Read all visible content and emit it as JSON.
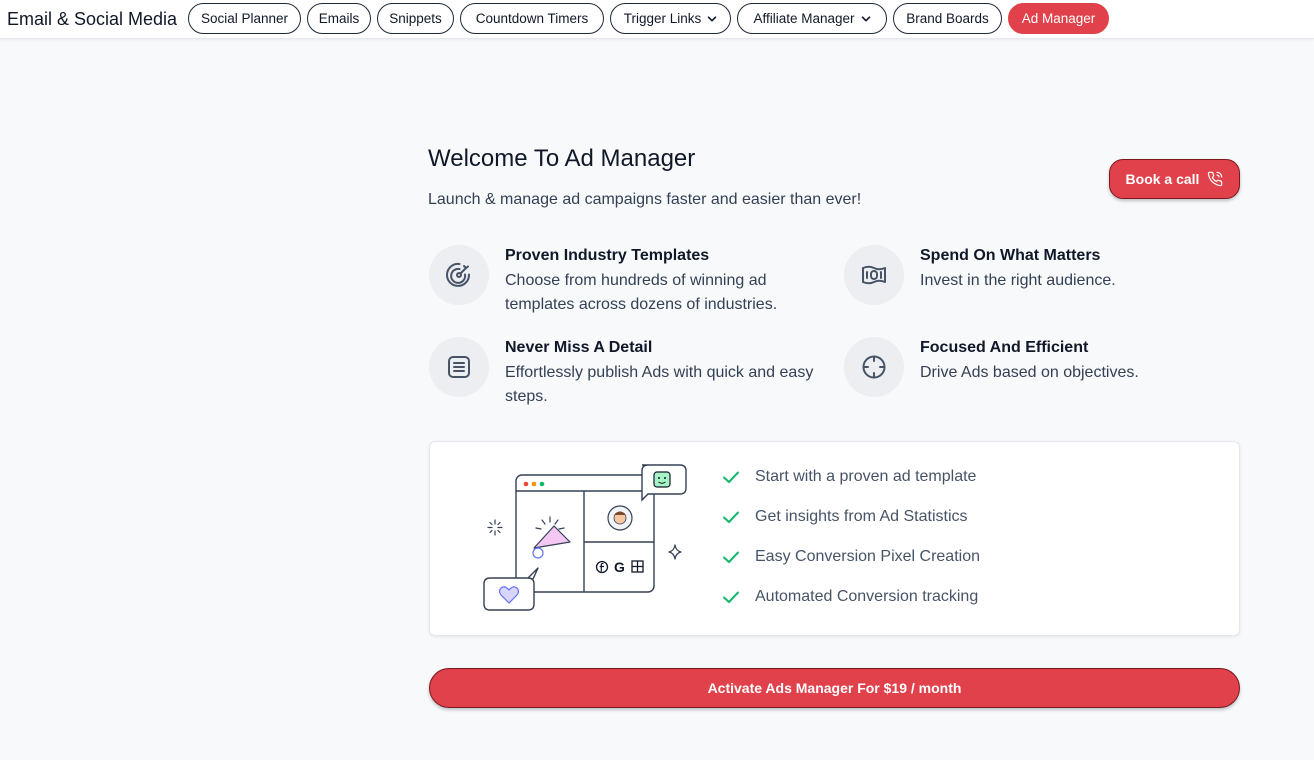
{
  "header": {
    "app_title": "Email & Social Media",
    "tabs": [
      {
        "label": "Social Planner",
        "has_dropdown": false,
        "active": false
      },
      {
        "label": "Emails",
        "has_dropdown": false,
        "active": false
      },
      {
        "label": "Snippets",
        "has_dropdown": false,
        "active": false
      },
      {
        "label": "Countdown Timers",
        "has_dropdown": false,
        "active": false
      },
      {
        "label": "Trigger Links",
        "has_dropdown": true,
        "active": false
      },
      {
        "label": "Affiliate Manager",
        "has_dropdown": true,
        "active": false
      },
      {
        "label": "Brand Boards",
        "has_dropdown": false,
        "active": false
      },
      {
        "label": "Ad Manager",
        "has_dropdown": false,
        "active": true
      }
    ]
  },
  "main": {
    "title": "Welcome To Ad Manager",
    "subtitle": "Launch & manage ad campaigns faster and easier than ever!",
    "book_call_label": "Book a call",
    "features": [
      {
        "title": "Proven Industry Templates",
        "description": "Choose from hundreds of winning ad templates across dozens of industries.",
        "icon": "target-icon"
      },
      {
        "title": "Spend On What Matters",
        "description": "Invest in the right audience.",
        "icon": "money-icon"
      },
      {
        "title": "Never Miss A Detail",
        "description": "Effortlessly publish Ads with quick and easy steps.",
        "icon": "document-icon"
      },
      {
        "title": "Focused And Efficient",
        "description": "Drive Ads based on objectives.",
        "icon": "crosshair-icon"
      }
    ],
    "checklist": [
      "Start with a proven ad template",
      "Get insights from Ad Statistics",
      "Easy Conversion Pixel Creation",
      "Automated Conversion tracking"
    ],
    "activate_label": "Activate Ads Manager For $19 / month"
  },
  "colors": {
    "accent": "#e0414a",
    "check": "#12b76a",
    "background": "#f8f9fb"
  }
}
